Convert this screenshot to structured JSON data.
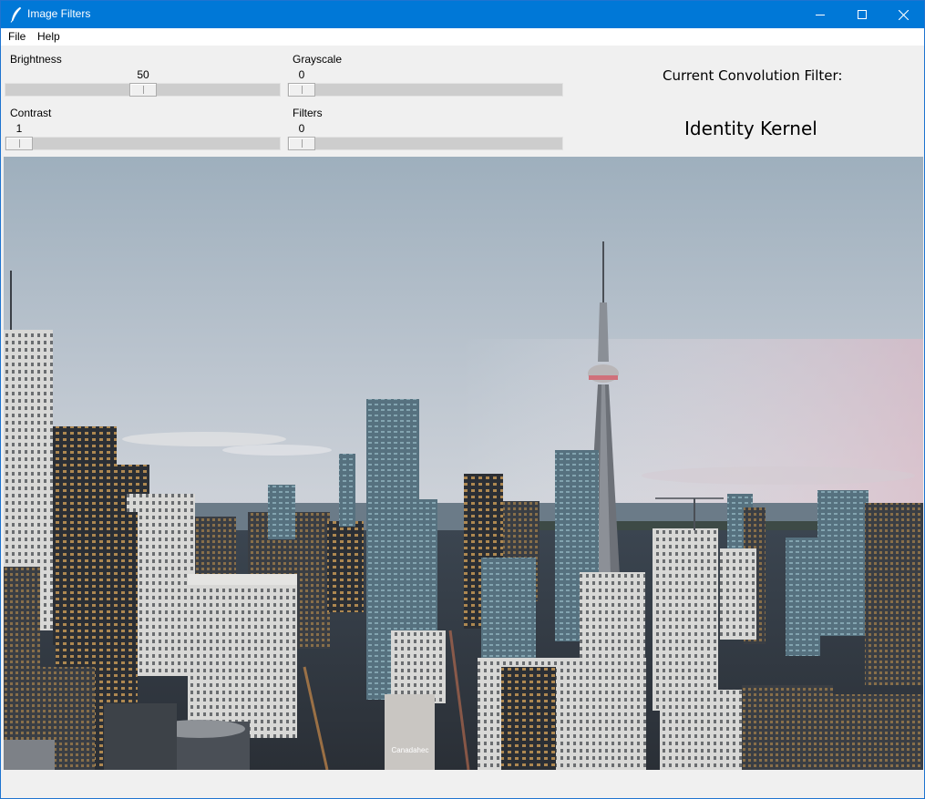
{
  "window": {
    "title": "Image Filters"
  },
  "menu": {
    "items": [
      "File",
      "Help"
    ]
  },
  "controls": {
    "brightness": {
      "label": "Brightness",
      "value": "50",
      "fraction": 0.5
    },
    "grayscale": {
      "label": "Grayscale",
      "value": "0",
      "fraction": 0.0
    },
    "contrast": {
      "label": "Contrast",
      "value": "1",
      "fraction": 0.0
    },
    "filters": {
      "label": "Filters",
      "value": "0",
      "fraction": 0.0
    }
  },
  "convolution": {
    "title": "Current Convolution Filter:",
    "name": "Identity Kernel"
  },
  "image": {
    "label": "Canadahec"
  },
  "icons": {
    "app": "feather-icon",
    "minimize": "minimize-icon",
    "maximize": "maximize-icon",
    "close": "close-icon"
  },
  "colors": {
    "titlebar": "#0078d7",
    "background": "#f0f0f0",
    "trough": "#cdcdcd"
  }
}
